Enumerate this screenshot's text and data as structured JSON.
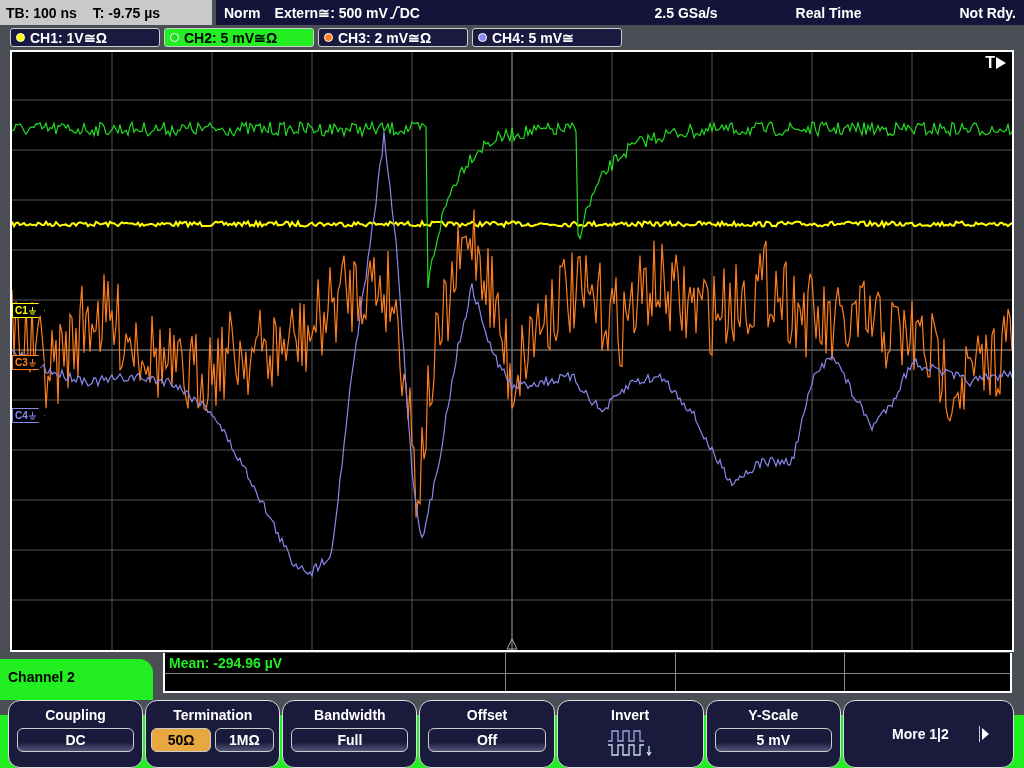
{
  "status_bar": {
    "timebase": "TB: 100 ns",
    "trigger_time": "T: -9.75 µs",
    "mode": "Norm",
    "trigger_source": "Extern≅: 500 mV",
    "trigger_coupling": "DC",
    "sample_rate": "2.5 GSa/s",
    "acquisition": "Real Time",
    "state": "Not Rdy."
  },
  "channels": [
    {
      "label": "CH1: 1V≅Ω",
      "color": "#ffff00",
      "selected": false,
      "marker": "C1"
    },
    {
      "label": "CH2: 5 mV≅Ω",
      "color": "#22dd22",
      "selected": true
    },
    {
      "label": "CH3: 2 mV≅Ω",
      "color": "#ff7f1e",
      "selected": false,
      "marker": "C3"
    },
    {
      "label": "CH4: 5 mV≅",
      "color": "#8888ee",
      "selected": false,
      "marker": "C4"
    }
  ],
  "trigger_marker": "T",
  "measurement": "Mean: -294.96 µV",
  "menu": {
    "title": "Channel 2",
    "softkeys": [
      {
        "kind": "value",
        "label": "Coupling",
        "value": "DC"
      },
      {
        "kind": "toggle",
        "label": "Termination",
        "options": [
          {
            "label": "50Ω",
            "selected": true
          },
          {
            "label": "1MΩ",
            "selected": false
          }
        ]
      },
      {
        "kind": "value",
        "label": "Bandwidth",
        "value": "Full"
      },
      {
        "kind": "value",
        "label": "Offset",
        "value": "Off"
      },
      {
        "kind": "icon",
        "label": "Invert"
      },
      {
        "kind": "value",
        "label": "Y-Scale",
        "value": "5 mV"
      },
      {
        "kind": "more",
        "label": "More 1|2"
      }
    ]
  }
}
